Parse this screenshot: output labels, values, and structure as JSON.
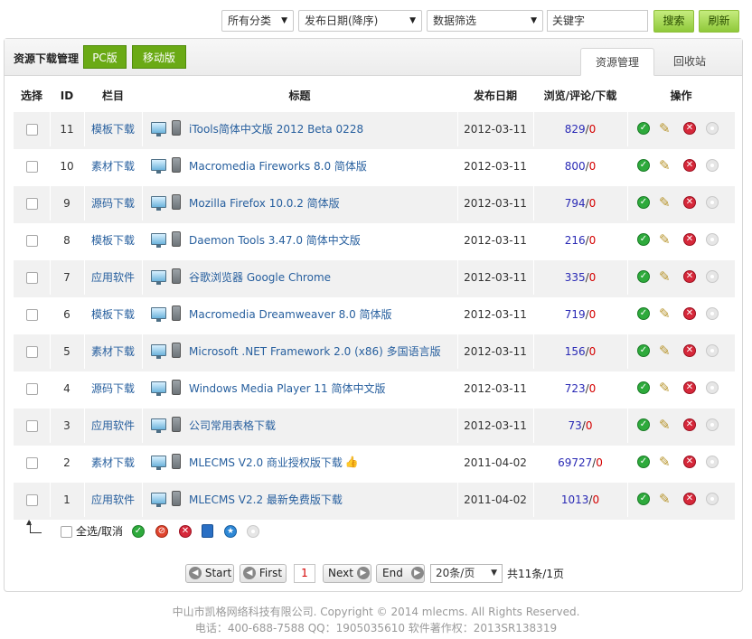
{
  "filters": {
    "category": "所有分类",
    "sort": "发布日期(降序)",
    "data_filter": "数据筛选",
    "keyword_placeholder": "关键字",
    "search_label": "搜索",
    "refresh_label": "刷新"
  },
  "panel": {
    "title": "资源下载管理",
    "version_tabs": [
      "PC版",
      "移动版"
    ],
    "tabs": [
      "资源管理",
      "回收站"
    ],
    "active_tab": "资源管理"
  },
  "table": {
    "headers": [
      "选择",
      "ID",
      "栏目",
      "标题",
      "发布日期",
      "浏览/评论/下载",
      "操作"
    ],
    "rows": [
      {
        "id": "11",
        "category": "模板下载",
        "title": "iTools简体中文版 2012 Beta 0228",
        "date": "2012-03-11",
        "views": "829",
        "comments": "0",
        "hot": false
      },
      {
        "id": "10",
        "category": "素材下载",
        "title": "Macromedia Fireworks 8.0 简体版",
        "date": "2012-03-11",
        "views": "800",
        "comments": "0",
        "hot": false
      },
      {
        "id": "9",
        "category": "源码下载",
        "title": "Mozilla Firefox 10.0.2 简体版",
        "date": "2012-03-11",
        "views": "794",
        "comments": "0",
        "hot": false
      },
      {
        "id": "8",
        "category": "模板下载",
        "title": "Daemon Tools 3.47.0 简体中文版",
        "date": "2012-03-11",
        "views": "216",
        "comments": "0",
        "hot": false
      },
      {
        "id": "7",
        "category": "应用软件",
        "title": "谷歌浏览器 Google Chrome",
        "date": "2012-03-11",
        "views": "335",
        "comments": "0",
        "hot": false
      },
      {
        "id": "6",
        "category": "模板下载",
        "title": "Macromedia Dreamweaver 8.0 简体版",
        "date": "2012-03-11",
        "views": "719",
        "comments": "0",
        "hot": false
      },
      {
        "id": "5",
        "category": "素材下载",
        "title": "Microsoft .NET Framework 2.0 (x86) 多国语言版",
        "date": "2012-03-11",
        "views": "156",
        "comments": "0",
        "hot": false
      },
      {
        "id": "4",
        "category": "源码下载",
        "title": "Windows Media Player 11 简体中文版",
        "date": "2012-03-11",
        "views": "723",
        "comments": "0",
        "hot": false
      },
      {
        "id": "3",
        "category": "应用软件",
        "title": "公司常用表格下载",
        "date": "2012-03-11",
        "views": "73",
        "comments": "0",
        "hot": false
      },
      {
        "id": "2",
        "category": "素材下载",
        "title": "MLECMS V2.0 商业授权版下载",
        "date": "2011-04-02",
        "views": "69727",
        "comments": "0",
        "hot": true
      },
      {
        "id": "1",
        "category": "应用软件",
        "title": "MLECMS V2.2 最新免费版下载",
        "date": "2011-04-02",
        "views": "1013",
        "comments": "0",
        "hot": false
      }
    ]
  },
  "bulk": {
    "select_all_label": "全选/取消"
  },
  "pager": {
    "start": "Start",
    "first": "First",
    "current_page": "1",
    "next": "Next",
    "end": "End",
    "per_page": "20条/页",
    "summary": "共11条/1页"
  },
  "footer": {
    "line1": "中山市凯格网络科技有限公司. Copyright © 2014 mlecms. All Rights Reserved.",
    "line2": "电话：400-688-7588  QQ：1905035610  软件著作权：2013SR138319"
  },
  "colors": {
    "accent_green": "#6aaa15",
    "link_blue": "#275f9e",
    "views_blue": "#2a2ab5",
    "count_red": "#d40000"
  }
}
